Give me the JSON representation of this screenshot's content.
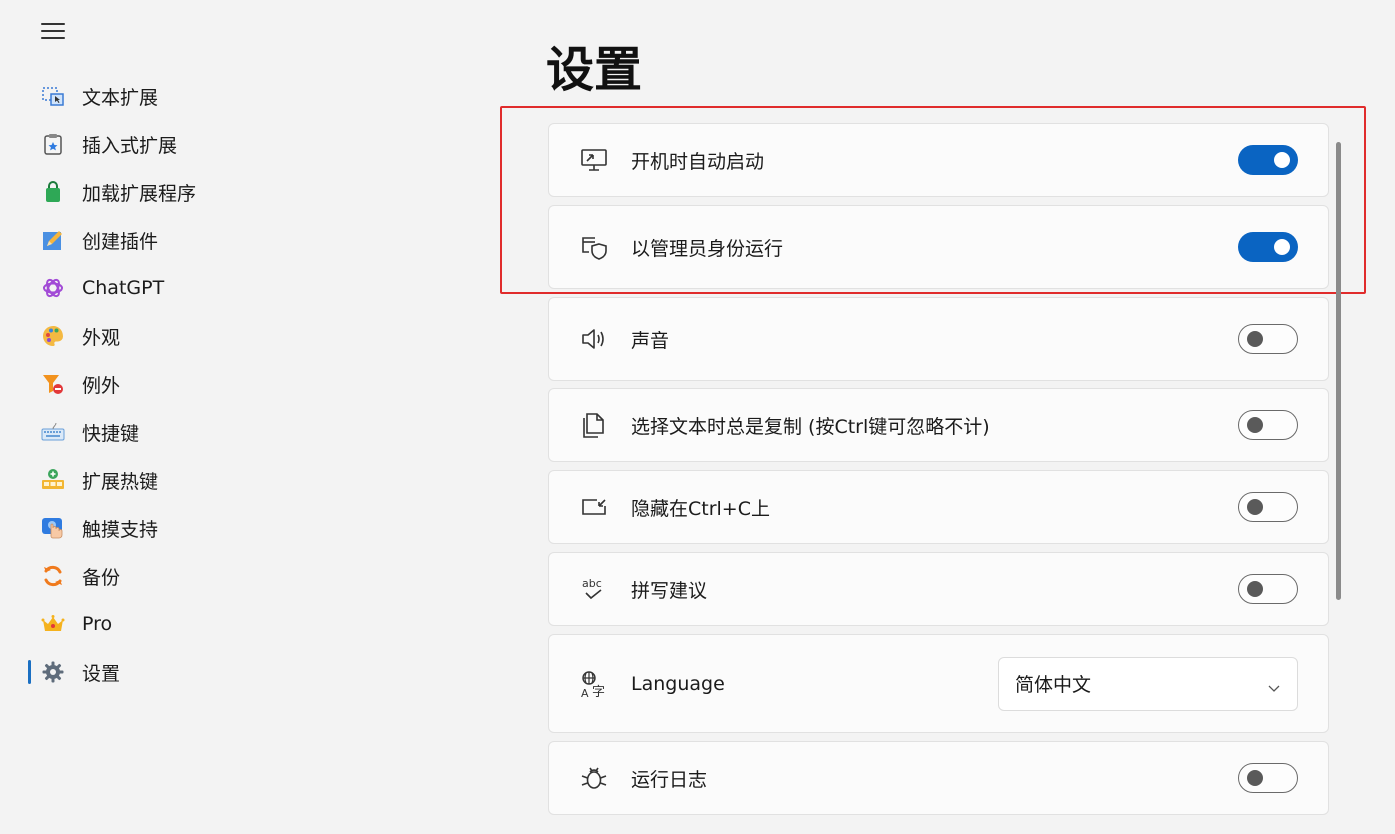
{
  "sidebar": {
    "items": [
      {
        "id": "text-ext",
        "label": "文本扩展",
        "icon": "text-expansion-icon"
      },
      {
        "id": "insert-ext",
        "label": "插入式扩展",
        "icon": "clipboard-star-icon"
      },
      {
        "id": "load-ext",
        "label": "加载扩展程序",
        "icon": "shopping-bag-icon"
      },
      {
        "id": "create-plugin",
        "label": "创建插件",
        "icon": "pencil-icon"
      },
      {
        "id": "chatgpt",
        "label": "ChatGPT",
        "icon": "chatgpt-logo-icon"
      },
      {
        "id": "appearance",
        "label": "外观",
        "icon": "palette-icon"
      },
      {
        "id": "exceptions",
        "label": "例外",
        "icon": "filter-exclude-icon"
      },
      {
        "id": "shortcuts",
        "label": "快捷键",
        "icon": "keyboard-icon"
      },
      {
        "id": "ext-hotkeys",
        "label": "扩展热键",
        "icon": "hotkey-add-icon"
      },
      {
        "id": "touch",
        "label": "触摸支持",
        "icon": "touch-icon"
      },
      {
        "id": "backup",
        "label": "备份",
        "icon": "sync-icon"
      },
      {
        "id": "pro",
        "label": "Pro",
        "icon": "crown-icon"
      },
      {
        "id": "settings",
        "label": "设置",
        "icon": "gear-icon",
        "active": true
      }
    ]
  },
  "page": {
    "title": "设置"
  },
  "settings": {
    "autostart": {
      "label": "开机时自动启动",
      "icon": "monitor-icon",
      "on": true
    },
    "admin": {
      "label": "以管理员身份运行",
      "icon": "shield-window-icon",
      "on": true
    },
    "sound": {
      "label": "声音",
      "icon": "speaker-icon",
      "on": false
    },
    "copy": {
      "label": "选择文本时总是复制 (按Ctrl键可忽略不计)",
      "icon": "copy-icon",
      "on": false
    },
    "hide": {
      "label": "隐藏在Ctrl+C上",
      "icon": "window-arrow-icon",
      "on": false
    },
    "spell": {
      "label": "拼写建议",
      "icon": "spellcheck-icon",
      "on": false
    },
    "language": {
      "label": "Language",
      "icon": "language-icon",
      "value": "简体中文"
    },
    "log": {
      "label": "运行日志",
      "icon": "bug-icon",
      "on": false
    }
  },
  "colors": {
    "accent": "#0a64c2",
    "highlight": "#e02b2b"
  }
}
